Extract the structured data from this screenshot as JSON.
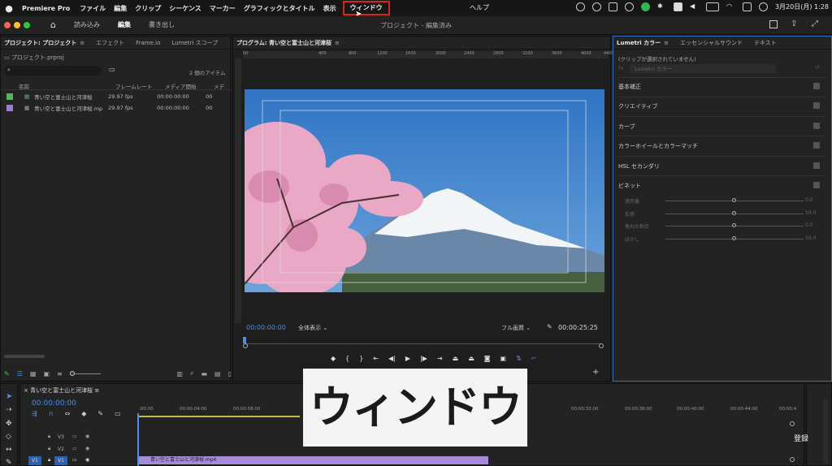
{
  "menubar": {
    "app_name": "Premiere Pro",
    "items": [
      "ファイル",
      "編集",
      "クリップ",
      "シーケンス",
      "マーカー",
      "グラフィックとタイトル",
      "表示"
    ],
    "highlighted_item": "ウィンドウ",
    "help": "ヘルプ",
    "clock": "3月20日(月)  1:28"
  },
  "app_header": {
    "tabs": [
      "読み込み",
      "編集",
      "書き出し"
    ],
    "active_tab": "編集",
    "title": "プロジェクト - 編集済み"
  },
  "project_panel": {
    "tabs": [
      "プロジェクト: プロジェクト",
      "エフェクト",
      "Frame.io",
      "Lumetri スコープ"
    ],
    "file": "プロジェクト.prproj",
    "item_count": "2 個のアイテム",
    "columns": [
      "名前",
      "フレームレート",
      "メディア開始",
      "メデ"
    ],
    "rows": [
      {
        "name": "青い空と富士山と河津桜",
        "fps": "29.97 fps",
        "start": "00:00:00:00",
        "color": "#5ab55a"
      },
      {
        "name": "青い空と富士山と河津桜.mp",
        "fps": "29.97 fps",
        "start": "00:00:00:00",
        "color": "#9a7dd8"
      }
    ]
  },
  "program_monitor": {
    "title": "プログラム: 青い空と富士山と河津桜",
    "ruler_ticks": [
      "00",
      "400",
      "800",
      "1200",
      "1600",
      "2000",
      "2400",
      "2800",
      "3200",
      "3600",
      "4000",
      "4400"
    ],
    "timecode_current": "00:00:00:00",
    "zoom": "全体表示",
    "quality": "フル画質",
    "timecode_duration": "00:00:25:25"
  },
  "lumetri_panel": {
    "tabs": [
      "Lumetri カラー",
      "エッセンシャルサウンド",
      "テキスト"
    ],
    "no_clip": "(クリップが選択されていません)",
    "preset": "Lumetri カラー",
    "sections": [
      "基本補正",
      "クリエイティブ",
      "カーブ",
      "カラーホイールとカラーマッチ",
      "HSL セカンダリ",
      "ビネット"
    ],
    "vignette": [
      {
        "label": "適用量",
        "value": "0.0"
      },
      {
        "label": "拡張",
        "value": "50.0"
      },
      {
        "label": "角丸の割合",
        "value": "0.0"
      },
      {
        "label": "ぼかし",
        "value": "50.0"
      }
    ]
  },
  "timeline": {
    "title": "青い空と富士山と河津桜",
    "timecode": "00:00:00:00",
    "ruler_labels": [
      ":00:00",
      "00:00:04:00",
      "00:00:08:00",
      "00:00:32:00",
      "00:00:36:00",
      "00:00:40:00",
      "00:00:44:00",
      "00:00:4"
    ],
    "tracks": [
      "V3",
      "V2",
      "V1"
    ],
    "clip_label": "青い空と富士山と河津桜.mp4",
    "register_label": "登録"
  },
  "caption": "ウィンドウ"
}
